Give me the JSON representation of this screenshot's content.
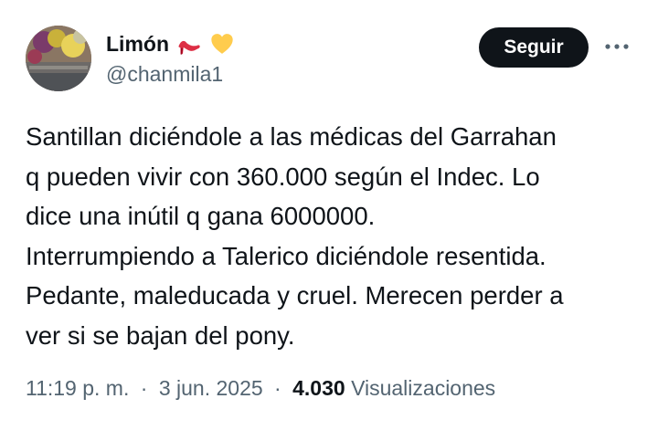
{
  "author": {
    "display_name": "Limón",
    "handle": "@chanmila1",
    "emojis": [
      "high-heel-icon",
      "yellow-heart-icon"
    ]
  },
  "actions": {
    "follow_label": "Seguir",
    "more_icon": "more-horizontal-icon"
  },
  "tweet": {
    "text": "Santillan diciéndole a las médicas del Garrahan\nq pueden vivir con 360.000 según el Indec. Lo\ndice una inútil q gana 6000000.\nInterrumpiendo a Talerico diciéndole resentida.\nPedante, maleducada y cruel. Merecen perder a\nver si se bajan del pony.",
    "time": "11:19 p. m.",
    "separator": "·",
    "date": "3 jun. 2025",
    "views_count": "4.030",
    "views_label": "Visualizaciones"
  },
  "colors": {
    "text_primary": "#0f1419",
    "text_secondary": "#536471",
    "button_bg": "#0f1419",
    "heart": "#ffcc4d",
    "heel": "#dd2e44"
  }
}
